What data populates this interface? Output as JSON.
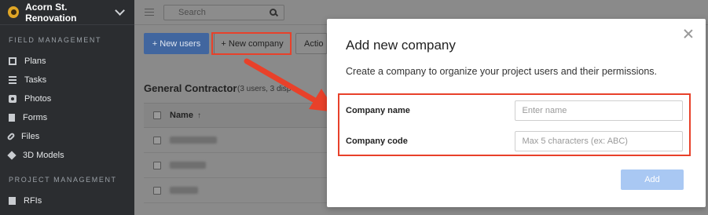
{
  "sidebar": {
    "project_name": "Acorn St. Renovation",
    "sections": [
      {
        "heading": "FIELD MANAGEMENT",
        "items": [
          {
            "label": "Plans",
            "icon": "plans-icon"
          },
          {
            "label": "Tasks",
            "icon": "tasks-icon"
          },
          {
            "label": "Photos",
            "icon": "camera-icon"
          },
          {
            "label": "Forms",
            "icon": "forms-icon"
          },
          {
            "label": "Files",
            "icon": "paperclip-icon"
          },
          {
            "label": "3D Models",
            "icon": "cube-icon"
          }
        ]
      },
      {
        "heading": "PROJECT MANAGEMENT",
        "items": [
          {
            "label": "RFIs",
            "icon": "rfi-icon"
          }
        ]
      }
    ]
  },
  "topbar": {
    "search_placeholder": "Search"
  },
  "toolbar": {
    "new_users_label": "+ New users",
    "new_company_label": "+ New company",
    "actions_label": "Actio"
  },
  "company": {
    "title": "General Contractor",
    "subtitle": "(3 users, 3 disp"
  },
  "table": {
    "name_header": "Name",
    "sort_icon": "↑"
  },
  "modal": {
    "title": "Add new company",
    "description": "Create a company to organize your project users and their permissions.",
    "fields": [
      {
        "label": "Company name",
        "placeholder": "Enter name"
      },
      {
        "label": "Company code",
        "placeholder": "Max 5 characters (ex: ABC)"
      }
    ],
    "add_label": "Add"
  },
  "colors": {
    "highlight": "#e8412a",
    "primary": "#41669f",
    "add_disabled": "#a9c8f3"
  }
}
